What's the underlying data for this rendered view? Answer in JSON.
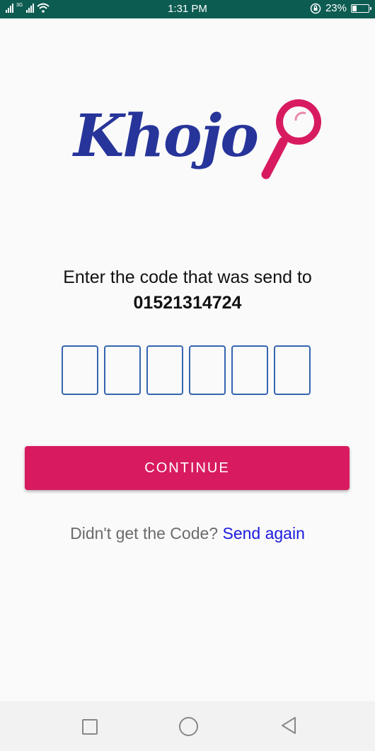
{
  "status_bar": {
    "network": "3G",
    "time": "1:31 PM",
    "battery_percent": "23%",
    "battery_level": 0.23
  },
  "logo": {
    "text": "Khojo"
  },
  "verify": {
    "prompt": "Enter the code that was send to",
    "phone": "01521314724",
    "code_length": 6,
    "code_digits": [
      "",
      "",
      "",
      "",
      "",
      ""
    ]
  },
  "actions": {
    "continue_label": "CONTINUE",
    "resend_question": "Didn't get the Code?",
    "resend_link": "Send again"
  },
  "colors": {
    "status_bar": "#0d5c52",
    "brand_text": "#27349a",
    "brand_accent": "#d81b60",
    "otp_border": "#3565b0",
    "link": "#1a1ae0"
  },
  "nav": {
    "icons": [
      "recents-square-icon",
      "home-circle-icon",
      "back-triangle-icon"
    ]
  }
}
